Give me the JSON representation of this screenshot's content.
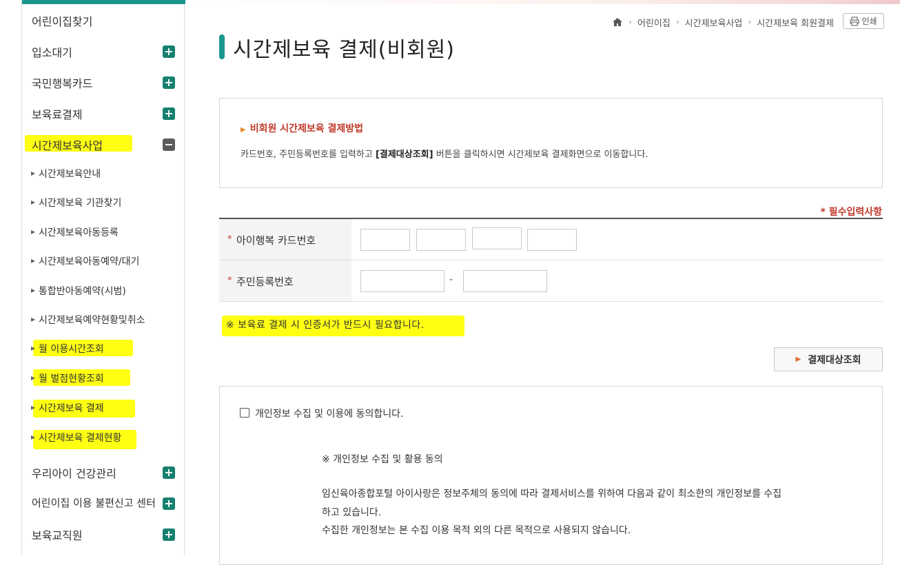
{
  "sidebar": {
    "items": [
      {
        "label": "어린이집찾기",
        "toggle": ""
      },
      {
        "label": "입소대기",
        "toggle": "+"
      },
      {
        "label": "국민행복카드",
        "toggle": "+"
      },
      {
        "label": "보육료결제",
        "toggle": "+"
      },
      {
        "label": "시간제보육사업",
        "toggle": "−"
      }
    ],
    "sub_items": [
      "시간제보육안내",
      "시간제보육 기관찾기",
      "시간제보육아동등록",
      "시간제보육아동예약/대기",
      "통합반아동예약(시범)",
      "시간제보육예약현황및취소",
      "월 이용시간조회",
      "월 벌점현황조회",
      "시간제보육 결제",
      "시간제보육 결제현황"
    ],
    "bottom_items": [
      {
        "label": "우리아이 건강관리",
        "toggle": "+"
      },
      {
        "label": "어린이집 이용 불편신고 센터",
        "toggle": "+"
      },
      {
        "label": "보육교직원",
        "toggle": "+"
      }
    ]
  },
  "breadcrumb": {
    "home_icon": "home-icon",
    "items": [
      "어린이집",
      "시간제보육사업",
      "시간제보육 회원결제"
    ]
  },
  "print_label": "인쇄",
  "page_title": "시간제보육 결제(비회원)",
  "info": {
    "title": "비회원 시간제보육 결제방법",
    "desc_before": "카드번호, 주민등록번호를 입력하고 ",
    "desc_bold": "[결제대상조회]",
    "desc_after": " 버튼을 클릭하시면 시간제보육 결제화면으로 이동합니다."
  },
  "required_note": "* 필수입력사항",
  "form": {
    "card_label": "아이행복 카드번호",
    "ssn_label": "주민등록번호",
    "ssn_separator": "-",
    "card_fields": [
      "",
      "",
      "",
      ""
    ],
    "ssn_fields": [
      "",
      ""
    ]
  },
  "warning": "※ 보육료 결제 시 인증서가 반드시 필요합니다.",
  "lookup_button": "결제대상조회",
  "consent": {
    "checkbox_label": "개인정보 수집 및 이용에 동의합니다.",
    "checked": false,
    "heading": "※ 개인정보 수집 및 활용 동의",
    "lines": [
      "임신육아종합포털 아이사랑은 정보주체의 동의에 따라 결제서비스를 위하여 다음과 같이 최소한의 개인정보를 수집",
      "하고 있습니다.",
      "수집한 개인정보는 본 수집 이용 목적 외의 다른 목적으로 사용되지 않습니다."
    ]
  },
  "colors": {
    "accent": "#19978f",
    "toggle_green": "#16806f",
    "toggle_gray": "#5b5b5b",
    "required_red": "#c0392b",
    "highlight": "#ffff14"
  }
}
